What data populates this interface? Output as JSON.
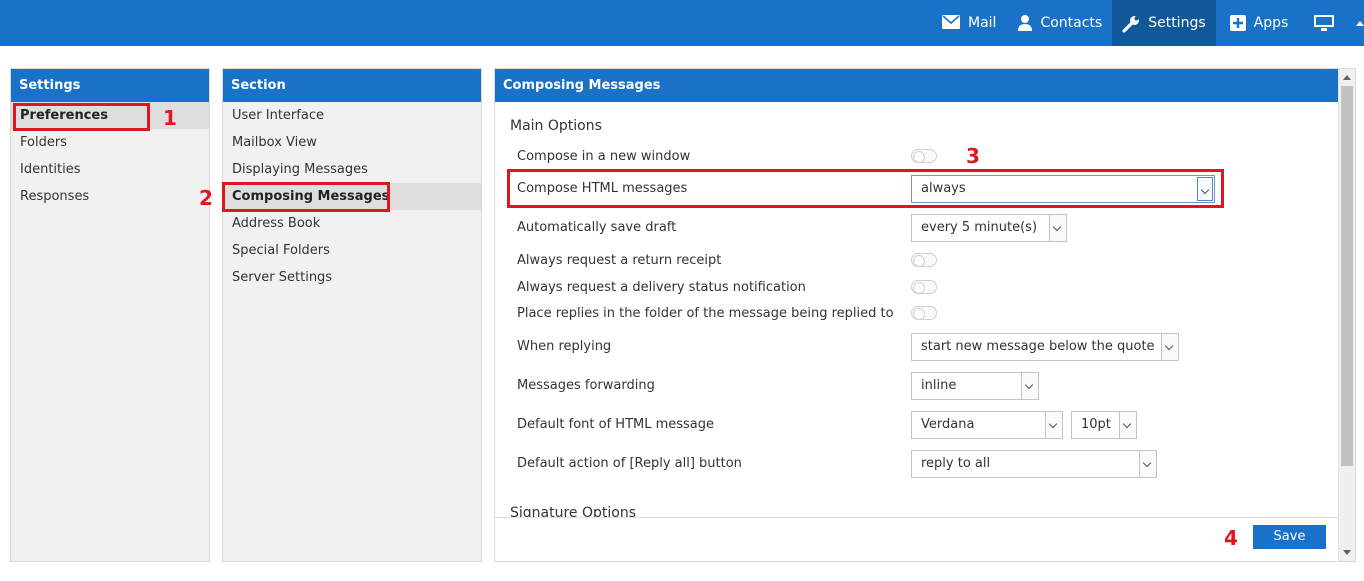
{
  "topnav": {
    "mail": "Mail",
    "contacts": "Contacts",
    "settings": "Settings",
    "apps": "Apps"
  },
  "settings_panel": {
    "title": "Settings",
    "items": [
      "Preferences",
      "Folders",
      "Identities",
      "Responses"
    ],
    "selected": "Preferences"
  },
  "section_panel": {
    "title": "Section",
    "items": [
      "User Interface",
      "Mailbox View",
      "Displaying Messages",
      "Composing Messages",
      "Address Book",
      "Special Folders",
      "Server Settings"
    ],
    "selected": "Composing Messages"
  },
  "content": {
    "title": "Composing Messages",
    "main_options_title": "Main Options",
    "compose_new_window": "Compose in a new window",
    "compose_html": "Compose HTML messages",
    "compose_html_value": "always",
    "autosave": "Automatically save draft",
    "autosave_value": "every 5 minute(s)",
    "return_receipt": "Always request a return receipt",
    "delivery_notification": "Always request a delivery status notification",
    "place_replies": "Place replies in the folder of the message being replied to",
    "when_replying": "When replying",
    "when_replying_value": "start new message below the quote",
    "forwarding": "Messages forwarding",
    "forwarding_value": "inline",
    "default_font": "Default font of HTML message",
    "default_font_value": "Verdana",
    "default_font_size": "10pt",
    "reply_all": "Default action of [Reply all] button",
    "reply_all_value": "reply to all",
    "signature_options_title": "Signature Options",
    "save_label": "Save"
  },
  "annotations": [
    "1",
    "2",
    "3",
    "4"
  ],
  "colors": {
    "brand": "#1a72c8",
    "annotation": "#e0161e"
  }
}
